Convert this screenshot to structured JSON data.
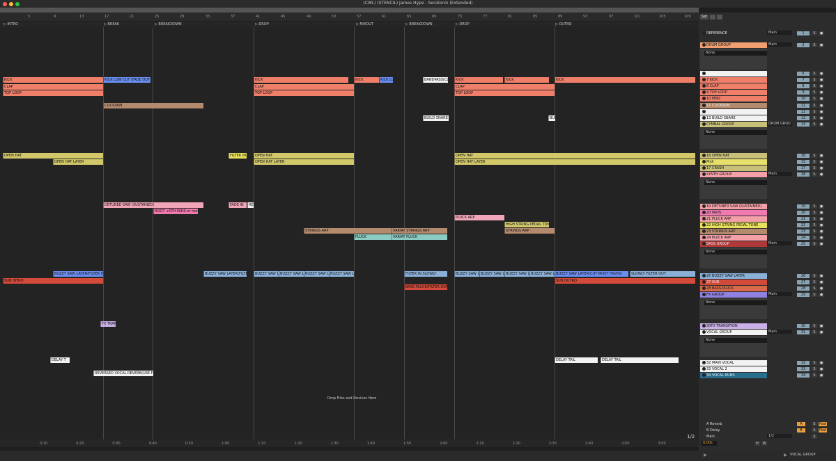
{
  "window": {
    "title": "(CWL) (STENCIL) James Hype - Seratonin (Extended)"
  },
  "colors": {
    "kick": "#f07f6a",
    "kick_blue": "#6a8ef0",
    "hat": "#d2c86a",
    "hat_yellow": "#e8e05a",
    "synth": "#f1a5b8",
    "arp": "#b48a6e",
    "pluck": "#8ccbc3",
    "bass": "#8ab0d8",
    "sub": "#d24a3a",
    "fx": "#c9b0e6",
    "vocal": "#f2f2f2",
    "vocal_green": "#8dd06a",
    "vocal_purple": "#a890d8",
    "vocal_blue": "#80b0e0"
  },
  "ruler": {
    "bars": [
      "5",
      "9",
      "13",
      "17",
      "21",
      "25",
      "29",
      "33",
      "37",
      "41",
      "45",
      "49",
      "53",
      "57",
      "61",
      "65",
      "69",
      "73",
      "77",
      "81",
      "85",
      "89",
      "93",
      "97",
      "101",
      "105",
      "109"
    ]
  },
  "locators": [
    {
      "label": "INTRO"
    },
    {
      "label": "BREAK"
    },
    {
      "label": "BREAKDOWN"
    },
    {
      "label": "DROP"
    },
    {
      "label": "MIXOUT"
    },
    {
      "label": "BREAKDOWN"
    },
    {
      "label": "DROP"
    },
    {
      "label": "OUTRO"
    }
  ],
  "clips": {
    "kick": [
      "KICK",
      "KICK LOW CUT (FADE OUT",
      "KICK",
      "KICK",
      "KICK LO",
      "BANDPASS(CLAP",
      "KICK",
      "KICK",
      "KICK"
    ],
    "clap": [
      "CLAP",
      "CLAP",
      "CLAP"
    ],
    "top_loop": [
      "TOP LOOP",
      "TOP LOOP",
      "TOP LOOP"
    ],
    "click": "CLICK/RIM",
    "build_snare": [
      "BUILD SNARE (",
      "BUI"
    ],
    "open_hat": [
      "OPEN HAT",
      "FILTER IN",
      "OPEN HAT",
      "OPEN HAT"
    ],
    "open_hat_layer": [
      "OPEN HAT LAYER",
      "OPEN HAT LAYER",
      "OPEN HAT LAYER"
    ],
    "detuned": [
      "DETUNED SAW (SUSTAINED)",
      "FADE IN",
      "REV"
    ],
    "pads": "ROOT +5TH PADS or reese",
    "pluck_arp": [
      "PLUCK ARP",
      "HIGH STRING PEDAL TONE"
    ],
    "strings": [
      "STRINGS ARP",
      "VARIAT STRINGS ARP",
      "STRINGS ARP"
    ],
    "pluck": [
      "PLUCK",
      "VARIAT PLUCK"
    ],
    "buzzy": [
      "BUZZY SAW LAYER(FILTER IN",
      "BUZZY SAW LAYER(FILTER",
      "BUZZY SAW L",
      "BUZZY SAW L",
      "BUZZY SAW L",
      "BUZZY SAW L",
      "FILTER IN SLOWLY",
      "BUZZY SAW L",
      "BUZZY SAW L",
      "BUZZY SAW L",
      "BUZZY SAW L",
      "BUZZY SAW LAYER(CUT MOST HIGHS)",
      "SLOWLY FILTER OUT"
    ],
    "sub": [
      "SUB INTRO",
      "SUB OUTRO"
    ],
    "bass_pluck": "BASS PLUCK(FILTER OUT",
    "fx": "FX TRAN",
    "main_vocal": [
      "DELAY T",
      "DELAY TAIL",
      "DELAY TAIL"
    ],
    "vocal2": "REVERSED VOCAL REVERB(USE FI",
    "drop_files": "Drop Files and Devices Here"
  },
  "time_ruler": [
    "0:10",
    "0:20",
    "0:30",
    "0:40",
    "0:50",
    "1:00",
    "1:10",
    "1:20",
    "1:30",
    "1:40",
    "1:50",
    "2:00",
    "2:10",
    "2:20",
    "2:30",
    "2:40",
    "2:50",
    "3:00"
  ],
  "page_indicator": "1/2",
  "mixer": {
    "set_label": "Set",
    "tracks": [
      {
        "name": "REFERENCE",
        "num": "1",
        "route": "Main"
      },
      {
        "name": "DRUM GROUP",
        "num": "2",
        "route": "Main",
        "group": true,
        "dd": "None"
      },
      {
        "name": "AUTOMATION NOTES DRUM GROU",
        "num": "6"
      },
      {
        "name": "7 KICK",
        "num": "7"
      },
      {
        "name": "8 CLAP",
        "num": "8"
      },
      {
        "name": "9 TOP LOOP",
        "num": "9"
      },
      {
        "name": "10 PERC",
        "num": "10"
      },
      {
        "name": "11 CLICK/RIM",
        "num": "11"
      },
      {
        "name": "12 FILL",
        "num": "12"
      },
      {
        "name": "13 BUILD SNARE",
        "num": "13"
      },
      {
        "name": "CYMBAL GROUP",
        "num": "14",
        "route": "DRUM GROU",
        "group": true,
        "dd": "None"
      },
      {
        "name": "16 OPEN HAT",
        "num": "16"
      },
      {
        "name": "Midi",
        "num": "15"
      },
      {
        "name": "17 CRASH",
        "num": "17"
      },
      {
        "name": "SYNTH GROUP",
        "num": "18",
        "route": "Main",
        "group": true,
        "dd": "None"
      },
      {
        "name": "19 DETUNED SAW (SUSTAINED)",
        "num": "19"
      },
      {
        "name": "20 PADS",
        "num": "20"
      },
      {
        "name": "21 PLUCK ARP",
        "num": "21"
      },
      {
        "name": "22 HIGH STRING PEDAL TONE",
        "num": "22"
      },
      {
        "name": "23 STRINGS ARP",
        "num": "23"
      },
      {
        "name": "24 PLUCK ARP",
        "num": "24"
      },
      {
        "name": "BASS GROUP",
        "num": "25",
        "route": "Main",
        "group": true,
        "dd": "None"
      },
      {
        "name": "26 BUZZY SAW LAYER",
        "num": "26"
      },
      {
        "name": "27 SUB",
        "num": "27"
      },
      {
        "name": "28 BASS PLUCK",
        "num": "28"
      },
      {
        "name": "FX GROUP",
        "num": "29",
        "route": "Main",
        "group": true,
        "dd": "None"
      },
      {
        "name": "30FX TRANSITION",
        "num": "30"
      },
      {
        "name": "VOCAL GROUP",
        "num": "31",
        "route": "Main",
        "group": true,
        "dd": "None"
      },
      {
        "name": "32 MAIN VOCAL",
        "num": "32"
      },
      {
        "name": "33 VOCAL 2",
        "num": "33"
      },
      {
        "name": "34 VOCAL RUNS",
        "num": "34"
      }
    ],
    "returns": [
      {
        "name": "A Reverb",
        "letter": "A",
        "post": "Post"
      },
      {
        "name": "B Delay",
        "letter": "B",
        "post": "Post"
      }
    ],
    "main": {
      "name": "Main",
      "route": "1/2"
    },
    "tempo_box": "0.00s",
    "hw": [
      "H",
      "W"
    ]
  },
  "status": {
    "track_name": "VOCAL GROUP"
  }
}
